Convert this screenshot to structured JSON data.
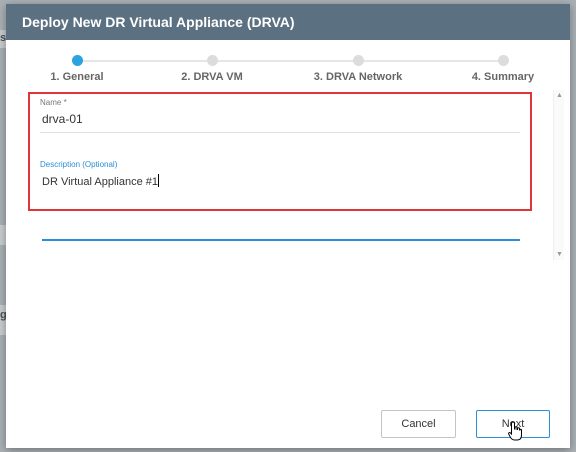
{
  "background": {
    "side_text_1": "s",
    "side_text_2": "g"
  },
  "dialog": {
    "title": "Deploy New DR Virtual Appliance (DRVA)"
  },
  "wizard": {
    "steps": [
      {
        "label": "1. General",
        "active": true
      },
      {
        "label": "2. DRVA VM",
        "active": false
      },
      {
        "label": "3. DRVA Network",
        "active": false
      },
      {
        "label": "4. Summary",
        "active": false
      }
    ]
  },
  "form": {
    "name_label": "Name *",
    "name_value": "drva-01",
    "description_label": "Description (Optional)",
    "description_value": "DR Virtual Appliance #1"
  },
  "footer": {
    "cancel_label": "Cancel",
    "next_label": "Next"
  },
  "colors": {
    "header": "#5b7080",
    "accent": "#2aa3e0",
    "highlight": "#e0353b"
  }
}
